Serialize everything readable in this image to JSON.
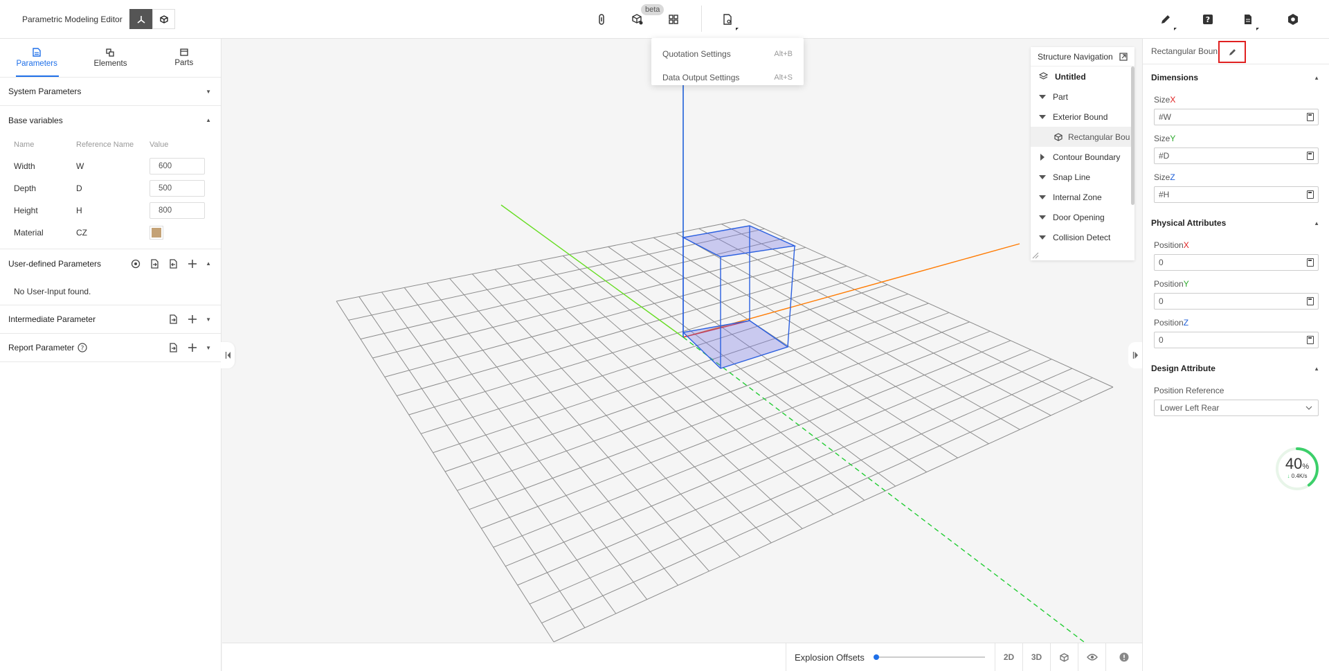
{
  "app": {
    "title": "Parametric Modeling Editor"
  },
  "toolbar": {
    "beta_label": "beta"
  },
  "dropdown": {
    "items": [
      {
        "label": "Quotation Settings",
        "shortcut": "Alt+B"
      },
      {
        "label": "Data Output Settings",
        "shortcut": "Alt+S"
      }
    ]
  },
  "left_panel": {
    "tabs": [
      {
        "label": "Parameters",
        "icon": "document-icon"
      },
      {
        "label": "Elements",
        "icon": "elements-icon"
      },
      {
        "label": "Parts",
        "icon": "folder-icon"
      }
    ],
    "system_parameters": "System Parameters",
    "base_variables": {
      "title": "Base variables",
      "columns": [
        "Name",
        "Reference Name",
        "Value"
      ],
      "rows": [
        {
          "name": "Width",
          "ref": "W",
          "value": "600"
        },
        {
          "name": "Depth",
          "ref": "D",
          "value": "500"
        },
        {
          "name": "Height",
          "ref": "H",
          "value": "800"
        },
        {
          "name": "Material",
          "ref": "CZ",
          "swatch": "#c4a276"
        }
      ]
    },
    "user_defined": {
      "title": "User-defined Parameters",
      "empty": "No User-Input found."
    },
    "intermediate": {
      "title": "Intermediate Parameter"
    },
    "report": {
      "title": "Report Parameter"
    }
  },
  "structure_nav": {
    "title": "Structure Navigation",
    "root": "Untitled",
    "items": [
      {
        "label": "Part",
        "expand": "down"
      },
      {
        "label": "Exterior Bound",
        "expand": "down"
      },
      {
        "label": "Rectangular Bou",
        "expand": "none",
        "selected": true
      },
      {
        "label": "Contour Boundary",
        "expand": "right"
      },
      {
        "label": "Snap Line",
        "expand": "down"
      },
      {
        "label": "Internal Zone",
        "expand": "down"
      },
      {
        "label": "Door Opening",
        "expand": "down"
      },
      {
        "label": "Collision Detect",
        "expand": "down"
      }
    ]
  },
  "bottom_bar": {
    "explosion_label": "Explosion Offsets",
    "explosion_value": 0,
    "btn_2d": "2D",
    "btn_3d": "3D"
  },
  "right_panel": {
    "title": "Rectangular Bound",
    "dimensions": {
      "title": "Dimensions",
      "fields": [
        {
          "label": "Size",
          "axis": "X",
          "axis_color": "#e02020",
          "value": "#W"
        },
        {
          "label": "Size",
          "axis": "Y",
          "axis_color": "#2eaa2e",
          "value": "#D"
        },
        {
          "label": "Size",
          "axis": "Z",
          "axis_color": "#1e5fd8",
          "value": "#H"
        }
      ]
    },
    "physical": {
      "title": "Physical Attributes",
      "fields": [
        {
          "label": "Position",
          "axis": "X",
          "axis_color": "#e02020",
          "value": "0"
        },
        {
          "label": "Position",
          "axis": "Y",
          "axis_color": "#2eaa2e",
          "value": "0"
        },
        {
          "label": "Position",
          "axis": "Z",
          "axis_color": "#1e5fd8",
          "value": "0"
        }
      ]
    },
    "design": {
      "title": "Design Attribute",
      "position_reference_label": "Position Reference",
      "position_reference_value": "Lower Left Rear"
    }
  },
  "speed_widget": {
    "percent": "40",
    "percent_sign": "%",
    "rate": "0.4K/s",
    "progress": 0.4
  }
}
